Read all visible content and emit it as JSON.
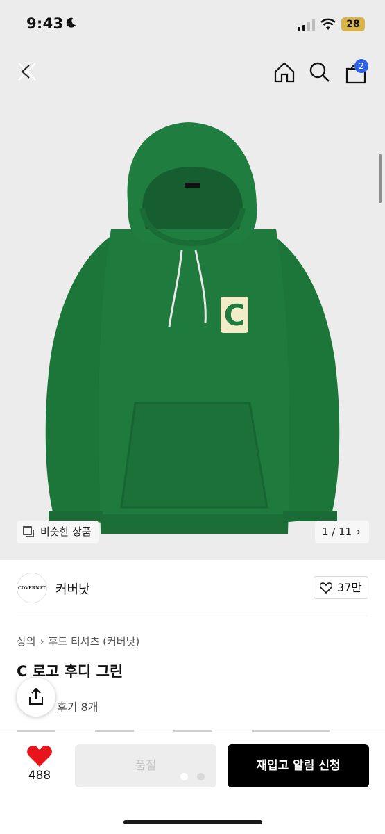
{
  "status_bar": {
    "time": "9:43",
    "battery": "28"
  },
  "nav": {
    "cart_count": "2"
  },
  "gallery": {
    "similar_label": "비슷한 상품",
    "page_indicator": "1 / 11",
    "logo_letter": "C"
  },
  "brand": {
    "logo_text": "COVERNAT",
    "name": "커버낫",
    "likes": "37만"
  },
  "breadcrumb": {
    "category": "상의",
    "subcategory": "후드 티셔츠 (커버낫)"
  },
  "product": {
    "title": "C 로고 후디 그린",
    "reviews": "후기 8개"
  },
  "bottom": {
    "wishlist_count": "488",
    "soldout_label": "품절",
    "restock_label": "재입고 알림 신청"
  },
  "colors": {
    "hoodie": "#1e7a3d",
    "badge": "#2f62e3",
    "battery": "#d8b44b"
  }
}
